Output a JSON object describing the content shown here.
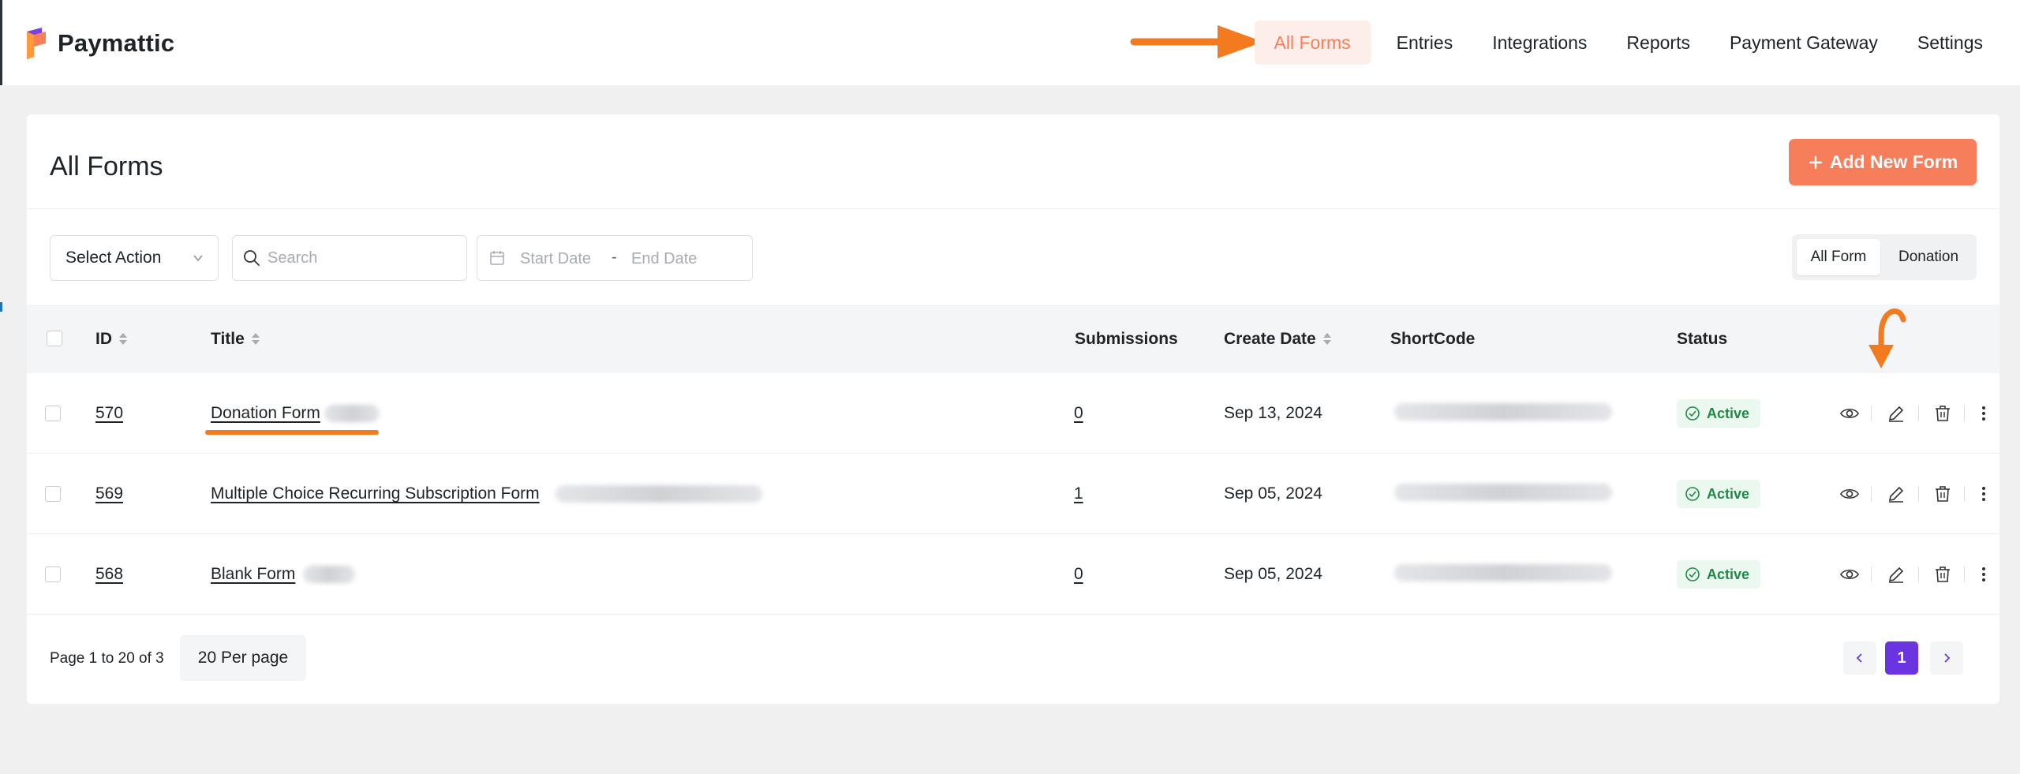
{
  "app": {
    "name": "Paymattic"
  },
  "nav": {
    "items": [
      "All Forms",
      "Entries",
      "Integrations",
      "Reports",
      "Payment Gateway",
      "Settings"
    ],
    "active": "All Forms"
  },
  "page": {
    "title": "All Forms",
    "add_button": "Add New Form"
  },
  "toolbar": {
    "select_action": "Select Action",
    "search_placeholder": "Search",
    "start_date_placeholder": "Start Date",
    "date_separator": "-",
    "end_date_placeholder": "End Date",
    "filters": [
      "All Form",
      "Donation"
    ],
    "active_filter": "All Form"
  },
  "table": {
    "columns": [
      "ID",
      "Title",
      "Submissions",
      "Create Date",
      "ShortCode",
      "Status"
    ],
    "rows": [
      {
        "id": "570",
        "title": "Donation Form",
        "submissions": "0",
        "create_date": "Sep 13, 2024",
        "status": "Active"
      },
      {
        "id": "569",
        "title": "Multiple Choice Recurring Subscription Form",
        "submissions": "1",
        "create_date": "Sep 05, 2024",
        "status": "Active"
      },
      {
        "id": "568",
        "title": "Blank Form",
        "submissions": "0",
        "create_date": "Sep 05, 2024",
        "status": "Active"
      }
    ]
  },
  "pagination": {
    "summary": "Page 1 to 20 of 3",
    "per_page": "20 Per page",
    "current_page": "1"
  },
  "colors": {
    "accent": "#f77e5b",
    "annotation": "#f37a1f",
    "active_badge": "#1f8a45",
    "page_current": "#6a35e0"
  },
  "icons": [
    "paymattic-logo-icon",
    "arrow-annotation-icon",
    "plus-icon",
    "search-icon",
    "calendar-icon",
    "chevron-down-icon",
    "sort-icon",
    "check-circle-icon",
    "eye-icon",
    "pencil-icon",
    "trash-icon",
    "more-vertical-icon",
    "chevron-left-icon",
    "chevron-right-icon"
  ]
}
